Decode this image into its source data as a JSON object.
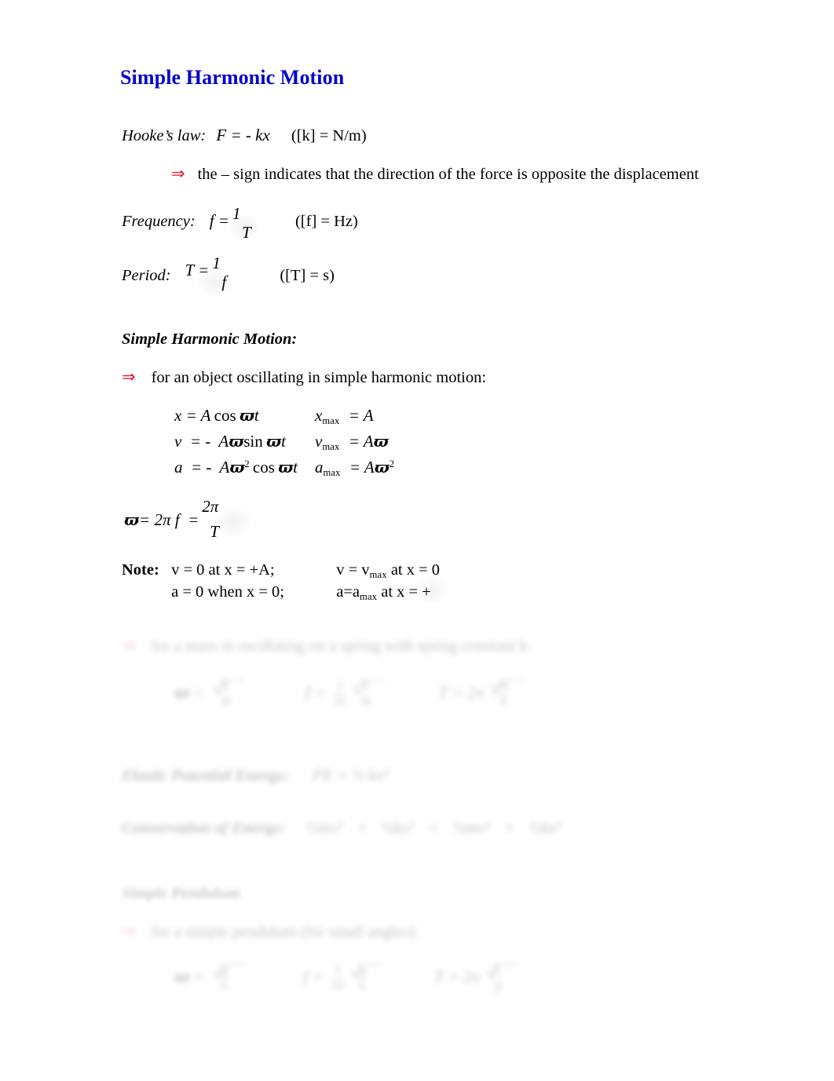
{
  "document": {
    "title": "Simple Harmonic Motion",
    "title_color": "#0000CC",
    "arrow_color": "#E8112D",
    "background": "#FFFFFF"
  },
  "icons": {
    "implies_arrow": "⇒",
    "radical": "√",
    "varpi": "ϖ",
    "pi": "π"
  },
  "hookes_law": {
    "label": "Hooke’s law:",
    "equation": "F = - kx",
    "units": "([k] = N/m)",
    "note": "the – sign indicates that the direction of the force is opposite the displacement"
  },
  "frequency": {
    "label": "Frequency:",
    "lhs": "f  =",
    "numerator": "1",
    "denominator": "T",
    "units": "([f] = Hz)"
  },
  "period": {
    "label": "Period:",
    "lhs": "T  =",
    "numerator": "1",
    "denominator": "f",
    "units": "([T] = s)"
  },
  "shm": {
    "heading": "Simple Harmonic Motion:",
    "intro": "for an object oscillating in simple harmonic motion:",
    "equations": [
      {
        "left_lhs": "x  =",
        "left_rhs": "A cos ϖt",
        "right_var": "x",
        "right_sub": "max",
        "right_rhs": "= A"
      },
      {
        "left_lhs": "v  = -",
        "left_rhs": "Aϖ sin ϖt",
        "right_var": "v",
        "right_sub": "max",
        "right_rhs": "= Aϖ"
      },
      {
        "left_lhs": "a  = -",
        "left_rhs": "Aϖ² cos ϖt",
        "right_var": "a",
        "right_sub": "max",
        "right_rhs": "= Aϖ²"
      }
    ],
    "omega_relation": {
      "lhs": "ϖ= 2π f  =",
      "numerator": "2π",
      "denominator": "T"
    },
    "note": {
      "label": "Note:",
      "rows": [
        {
          "col1": "v = 0 at x = +A;",
          "col2_pre": "v = v",
          "col2_sub": "max",
          "col2_post": " at x = 0"
        },
        {
          "col1": "a = 0 when x = 0;",
          "col2_pre": "a=a",
          "col2_sub": "max",
          "col2_post": " at x = +"
        }
      ]
    }
  },
  "spring": {
    "intro": "for a mass m oscillating on a spring with spring constant k:",
    "formulas": [
      {
        "lhs": "ϖ  =",
        "radicand_top": "k",
        "radicand_bottom": "m",
        "prefix": ""
      },
      {
        "lhs": "f  =",
        "radicand_top": "k",
        "radicand_bottom": "m",
        "prefix": "1 / 2π"
      },
      {
        "lhs": "T  =",
        "radicand_top": "m",
        "radicand_bottom": "k",
        "prefix": "2π"
      }
    ]
  },
  "elastic_pe": {
    "label": "Elastic Potential Energy:",
    "equation": "PE  =  ½ kx²"
  },
  "conservation": {
    "label": "Conservation of Energy:",
    "terms": [
      "½mv²",
      "+",
      "½kx²",
      "=",
      "½mv²",
      "+",
      "½kx²"
    ]
  },
  "pendulum": {
    "heading": "Simple Pendulum",
    "intro": "for a simple pendulum (for small angles):",
    "formulas": [
      {
        "lhs": "ϖ  =",
        "radicand_top": "g",
        "radicand_bottom": "L",
        "prefix": ""
      },
      {
        "lhs": "f  =",
        "radicand_top": "g",
        "radicand_bottom": "L",
        "prefix": "1 / 2π"
      },
      {
        "lhs": "T  =",
        "radicand_top": "L",
        "radicand_bottom": "g",
        "prefix": "2π"
      }
    ]
  }
}
